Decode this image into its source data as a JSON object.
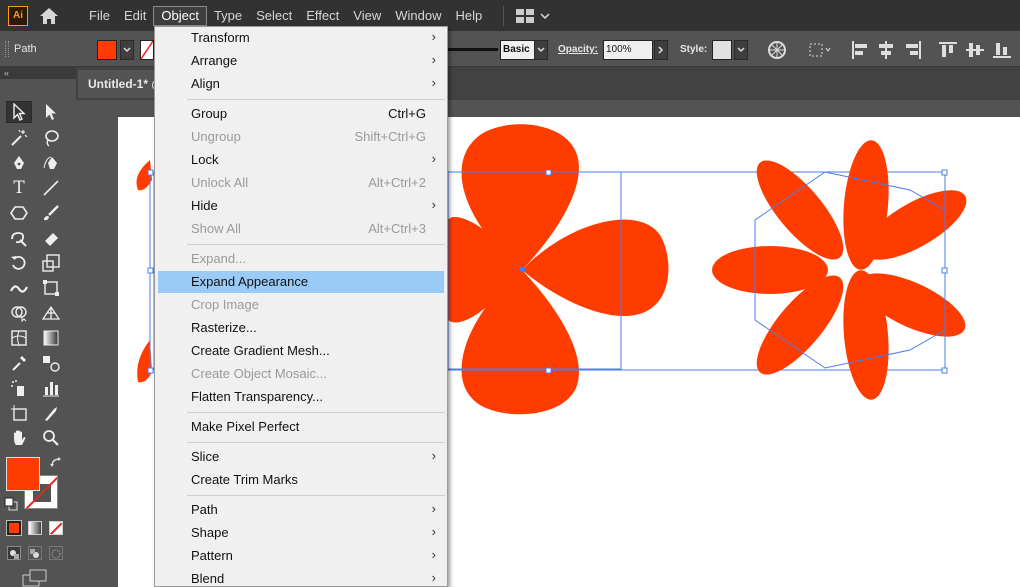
{
  "app": {
    "logo_text": "Ai",
    "logo_color": "#ff9a00"
  },
  "menubar": {
    "items": [
      {
        "label": "File"
      },
      {
        "label": "Edit"
      },
      {
        "label": "Object"
      },
      {
        "label": "Type"
      },
      {
        "label": "Select"
      },
      {
        "label": "Effect"
      },
      {
        "label": "View"
      },
      {
        "label": "Window"
      },
      {
        "label": "Help"
      }
    ],
    "active": "Object"
  },
  "controlbar": {
    "selection_label": "Path",
    "fill_color": "#ff3c00",
    "brush_name": "Basic",
    "opacity_label": "Opacity:",
    "opacity_value": "100%",
    "style_label": "Style:"
  },
  "document": {
    "tab_title": "Untitled-1* @"
  },
  "toolbar": {
    "collapse_glyph": "«",
    "fill_color": "#ff3c00",
    "stroke_color": "#ffffff"
  },
  "object_menu": {
    "items": [
      {
        "label": "Transform",
        "shortcut": "",
        "submenu": true,
        "enabled": true
      },
      {
        "label": "Arrange",
        "shortcut": "",
        "submenu": true,
        "enabled": true
      },
      {
        "label": "Align",
        "shortcut": "",
        "submenu": true,
        "enabled": true
      },
      {
        "label": "Group",
        "shortcut": "Ctrl+G",
        "submenu": false,
        "enabled": true
      },
      {
        "label": "Ungroup",
        "shortcut": "Shift+Ctrl+G",
        "submenu": false,
        "enabled": false
      },
      {
        "label": "Lock",
        "shortcut": "",
        "submenu": true,
        "enabled": true
      },
      {
        "label": "Unlock All",
        "shortcut": "Alt+Ctrl+2",
        "submenu": false,
        "enabled": false
      },
      {
        "label": "Hide",
        "shortcut": "",
        "submenu": true,
        "enabled": true
      },
      {
        "label": "Show All",
        "shortcut": "Alt+Ctrl+3",
        "submenu": false,
        "enabled": false
      },
      {
        "label": "Expand...",
        "shortcut": "",
        "submenu": false,
        "enabled": false
      },
      {
        "label": "Expand Appearance",
        "shortcut": "",
        "submenu": false,
        "enabled": true,
        "highlighted": true
      },
      {
        "label": "Crop Image",
        "shortcut": "",
        "submenu": false,
        "enabled": false
      },
      {
        "label": "Rasterize...",
        "shortcut": "",
        "submenu": false,
        "enabled": true
      },
      {
        "label": "Create Gradient Mesh...",
        "shortcut": "",
        "submenu": false,
        "enabled": true
      },
      {
        "label": "Create Object Mosaic...",
        "shortcut": "",
        "submenu": false,
        "enabled": false
      },
      {
        "label": "Flatten Transparency...",
        "shortcut": "",
        "submenu": false,
        "enabled": true
      },
      {
        "label": "Make Pixel Perfect",
        "shortcut": "",
        "submenu": false,
        "enabled": true
      },
      {
        "label": "Slice",
        "shortcut": "",
        "submenu": true,
        "enabled": true
      },
      {
        "label": "Create Trim Marks",
        "shortcut": "",
        "submenu": false,
        "enabled": true
      },
      {
        "label": "Path",
        "shortcut": "",
        "submenu": true,
        "enabled": true
      },
      {
        "label": "Shape",
        "shortcut": "",
        "submenu": true,
        "enabled": true
      },
      {
        "label": "Pattern",
        "shortcut": "",
        "submenu": true,
        "enabled": true
      },
      {
        "label": "Blend",
        "shortcut": "",
        "submenu": true,
        "enabled": true
      }
    ],
    "submenu_glyph": "›"
  },
  "artwork": {
    "shape_color": "#ff3c00",
    "selection_color": "#4a7cf0"
  },
  "colors": {
    "highlight": "#99cbf6",
    "menu_bg": "#f0f0f0",
    "ui_bg": "#535353",
    "menubar_bg": "#323232"
  }
}
